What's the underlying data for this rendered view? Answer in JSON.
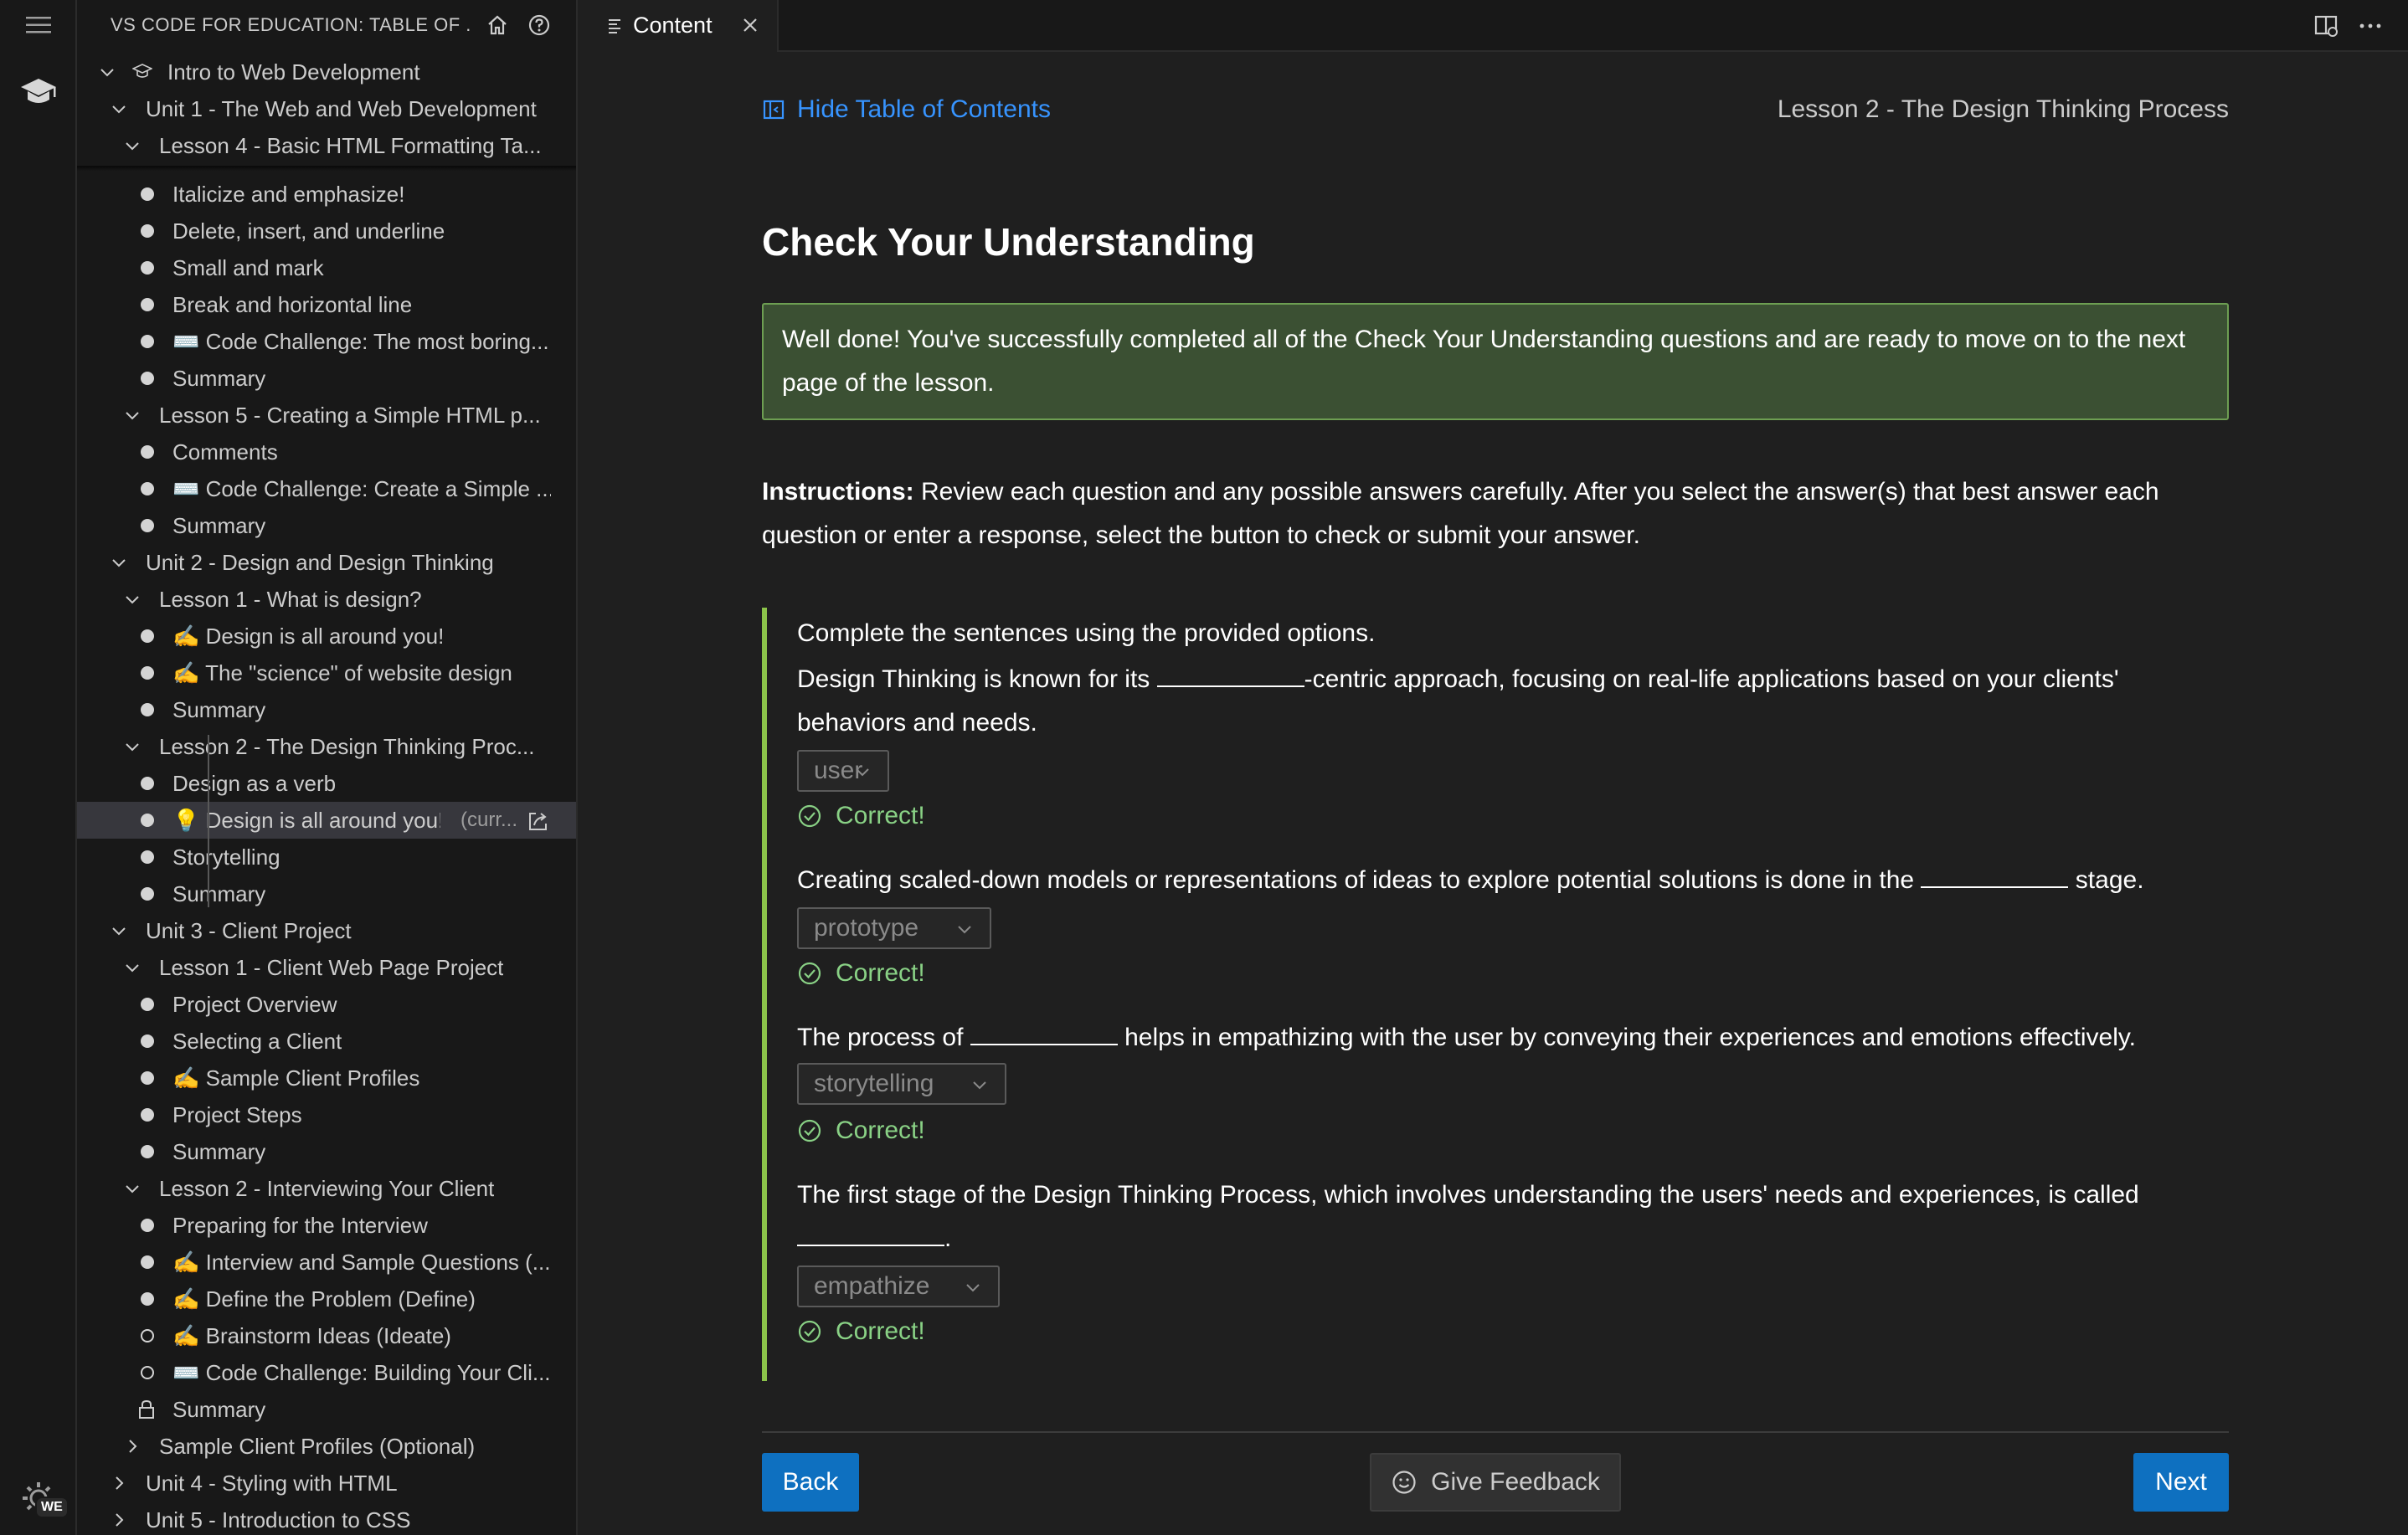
{
  "sidebar": {
    "title": "VS CODE FOR EDUCATION: TABLE OF ...",
    "tree": [
      {
        "label": "Intro to Web Development",
        "level": 0,
        "kind": "course"
      },
      {
        "label": "Unit 1 - The Web and Web Development",
        "level": 1,
        "kind": "expanded"
      },
      {
        "label": "Lesson 4 - Basic HTML Formatting Ta...",
        "level": 2,
        "kind": "expanded"
      },
      {
        "label": "Italicize and emphasize!",
        "kind": "page"
      },
      {
        "label": "Delete, insert, and underline",
        "kind": "page"
      },
      {
        "label": "Small and mark",
        "kind": "page"
      },
      {
        "label": "Break and horizontal line",
        "kind": "page"
      },
      {
        "label": "⌨️ Code Challenge: The most boring...",
        "kind": "page"
      },
      {
        "label": "Summary",
        "kind": "page"
      },
      {
        "label": "Lesson 5 - Creating a Simple HTML p...",
        "level": 2,
        "kind": "expanded"
      },
      {
        "label": "Comments",
        "kind": "page"
      },
      {
        "label": "⌨️ Code Challenge: Create a Simple ...",
        "kind": "page"
      },
      {
        "label": "Summary",
        "kind": "page"
      },
      {
        "label": "Unit 2 - Design and Design Thinking",
        "level": 1,
        "kind": "expanded"
      },
      {
        "label": "Lesson 1 - What is design?",
        "level": 2,
        "kind": "expanded"
      },
      {
        "label": "✍️ Design is all around you!",
        "kind": "page"
      },
      {
        "label": "✍️ The \"science\" of website design",
        "kind": "page"
      },
      {
        "label": "Summary",
        "kind": "page"
      },
      {
        "label": "Lesson 2 - The Design Thinking Proc...",
        "level": 2,
        "kind": "expanded"
      },
      {
        "label": "Design as a verb",
        "kind": "page"
      },
      {
        "label": "💡 Design is all around you!",
        "kind": "page-current",
        "suffix": "(curr..."
      },
      {
        "label": "Storytelling",
        "kind": "page"
      },
      {
        "label": "Summary",
        "kind": "page"
      },
      {
        "label": "Unit 3 - Client Project",
        "level": 1,
        "kind": "expanded"
      },
      {
        "label": "Lesson 1 - Client Web Page Project",
        "level": 2,
        "kind": "expanded"
      },
      {
        "label": "Project Overview",
        "kind": "page"
      },
      {
        "label": "Selecting a Client",
        "kind": "page"
      },
      {
        "label": "✍️ Sample Client Profiles",
        "kind": "page"
      },
      {
        "label": "Project Steps",
        "kind": "page"
      },
      {
        "label": "Summary",
        "kind": "page"
      },
      {
        "label": "Lesson 2 - Interviewing Your Client",
        "level": 2,
        "kind": "expanded"
      },
      {
        "label": "Preparing for the Interview",
        "kind": "page"
      },
      {
        "label": "✍️ Interview and Sample Questions (...",
        "kind": "page"
      },
      {
        "label": "✍️ Define the Problem (Define)",
        "kind": "page"
      },
      {
        "label": "✍️ Brainstorm Ideas (Ideate)",
        "kind": "page-hollow"
      },
      {
        "label": "⌨️ Code Challenge: Building Your Cli...",
        "kind": "page-hollow"
      },
      {
        "label": "Summary",
        "kind": "page-locked"
      },
      {
        "label": "Sample Client Profiles (Optional)",
        "level": 2,
        "kind": "collapsed"
      },
      {
        "label": "Unit 4 - Styling with HTML",
        "level": 1,
        "kind": "collapsed"
      },
      {
        "label": "Unit 5 - Introduction to CSS",
        "level": 1,
        "kind": "collapsed"
      }
    ]
  },
  "editor": {
    "tab_label": "Content",
    "toc_toggle": "Hide Table of Contents",
    "lesson_title": "Lesson 2 - The Design Thinking Process",
    "heading": "Check Your Understanding",
    "success_message": "Well done! You've successfully completed all of the Check Your Understanding questions and are ready to move on to the next page of the lesson.",
    "instructions_label": "Instructions:",
    "instructions_text": " Review each question and any possible answers carefully. After you select the answer(s) that best answer each question or enter a response, select the button to check or submit your answer.",
    "prompt": "Complete the sentences using the provided options.",
    "questions": [
      {
        "before": "Design Thinking is known for its ",
        "after": "-centric approach, focusing on real-life applications based on your clients' behaviors and needs.",
        "answer": "user",
        "result": "Correct!"
      },
      {
        "before": "Creating scaled-down models or representations of ideas to explore potential solutions is done in the ",
        "after": " stage.",
        "answer": "prototype",
        "result": "Correct!"
      },
      {
        "before": "The process of ",
        "after": " helps in empathizing with the user by conveying their experiences and emotions effectively.",
        "answer": "storytelling",
        "result": "Correct!"
      },
      {
        "before": "The first stage of the Design Thinking Process, which involves understanding the users' needs and experiences, is called ",
        "after": ".",
        "answer": "empathize",
        "result": "Correct!"
      }
    ],
    "back_label": "Back",
    "feedback_label": "Give Feedback",
    "next_label": "Next"
  },
  "activity_bar": {
    "badge": "WE"
  },
  "colors": {
    "accent_link": "#3794ff",
    "success_bg": "#3b5033",
    "success_border": "#6d9e52",
    "correct_text": "#89d185",
    "button_primary": "#0e70c0"
  }
}
